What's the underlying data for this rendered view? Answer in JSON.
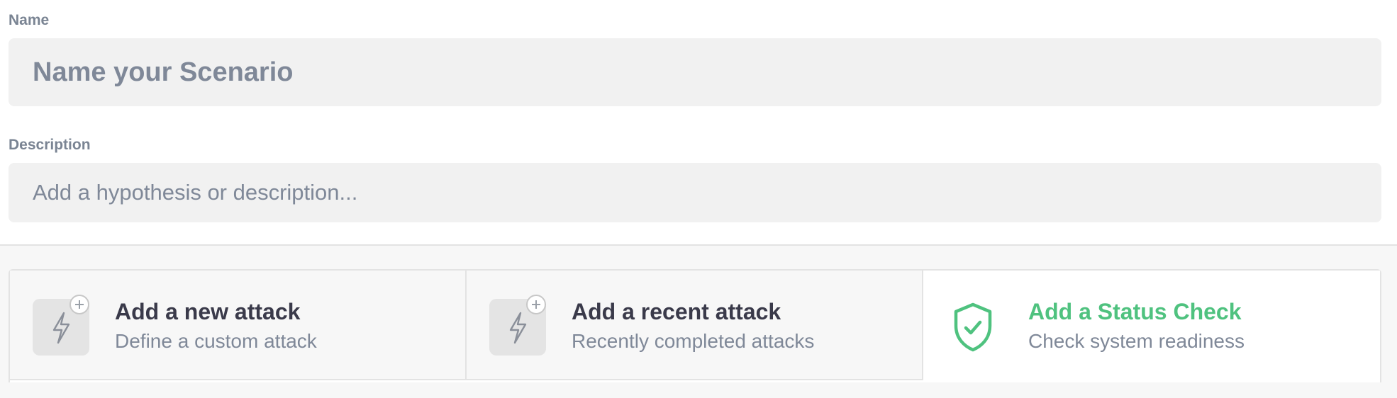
{
  "form": {
    "name_label": "Name",
    "name_placeholder": "Name your Scenario",
    "description_label": "Description",
    "description_placeholder": "Add a hypothesis or description..."
  },
  "tabs": [
    {
      "title": "Add a new attack",
      "subtitle": "Define a custom attack",
      "icon": "lightning-icon",
      "active": false
    },
    {
      "title": "Add a recent attack",
      "subtitle": "Recently completed attacks",
      "icon": "lightning-icon",
      "active": false
    },
    {
      "title": "Add a Status Check",
      "subtitle": "Check system readiness",
      "icon": "shield-check-icon",
      "active": true
    }
  ],
  "colors": {
    "accent_green": "#4fc27f",
    "field_bg": "#f1f1f1",
    "muted_text": "#7f8898"
  }
}
